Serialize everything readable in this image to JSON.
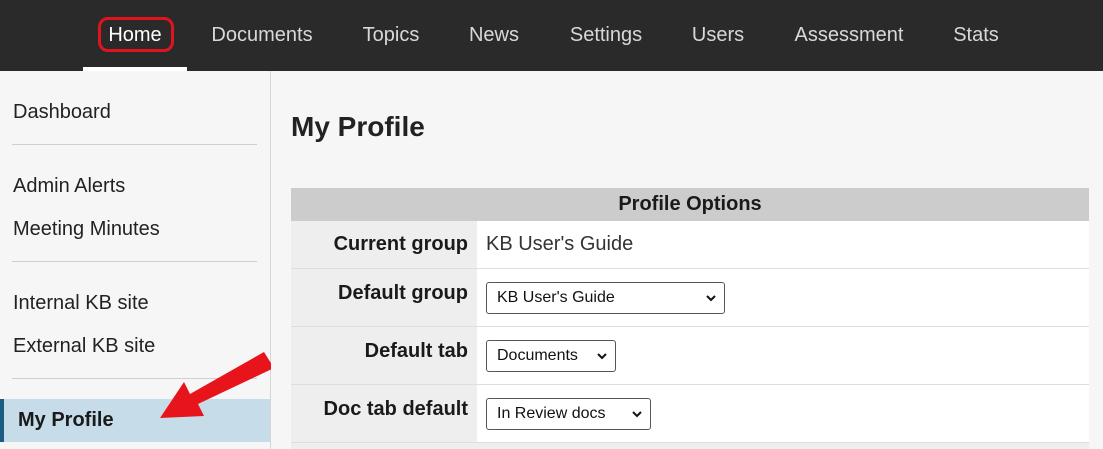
{
  "topnav": {
    "tabs": [
      {
        "label": "Home",
        "active": true
      },
      {
        "label": "Documents"
      },
      {
        "label": "Topics"
      },
      {
        "label": "News"
      },
      {
        "label": "Settings"
      },
      {
        "label": "Users"
      },
      {
        "label": "Assessment"
      },
      {
        "label": "Stats"
      }
    ]
  },
  "sidebar": {
    "items": [
      "Dashboard",
      "Admin Alerts",
      "Meeting Minutes",
      "Internal KB site",
      "External KB site",
      "My Profile"
    ],
    "active": "My Profile"
  },
  "main": {
    "title": "My Profile",
    "table": {
      "header": "Profile Options",
      "rows": [
        {
          "label": "Current group",
          "value": "KB User's Guide"
        },
        {
          "label": "Default group",
          "select": "KB User's Guide"
        },
        {
          "label": "Default tab",
          "select": "Documents"
        },
        {
          "label": "Doc tab default",
          "select": "In Review docs"
        }
      ]
    }
  },
  "colors": {
    "nav_bg": "#2a2a2a",
    "highlight_ring": "#e0141e",
    "active_sidebar_bg": "#c6dde9",
    "active_sidebar_border": "#1c5c82",
    "arrow": "#e8141c"
  }
}
